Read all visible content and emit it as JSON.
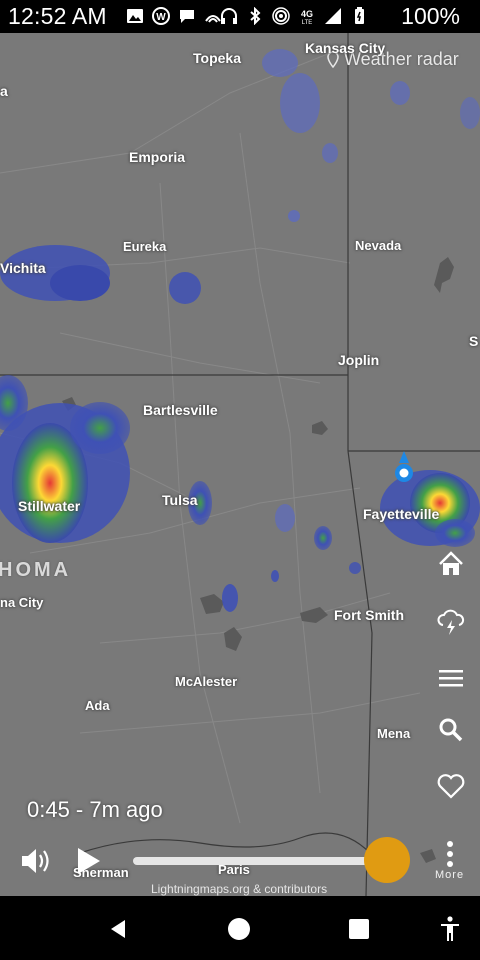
{
  "status_bar": {
    "time": "12:52 AM",
    "battery_percent": "100%",
    "left_icons": [
      "image-icon",
      "wordpress-icon",
      "chat-icon",
      "wifi-calling-icon"
    ],
    "right_icons": [
      "headphones-icon",
      "bluetooth-icon",
      "hotspot-icon",
      "4g-lte-icon",
      "signal-icon",
      "battery-icon"
    ]
  },
  "map": {
    "title": "Weather radar",
    "state_label": "HOMA",
    "cities": [
      {
        "id": "topeka",
        "name": "Topeka"
      },
      {
        "id": "kansas-city",
        "name": "Kansas City"
      },
      {
        "id": "edge-a",
        "name": "a"
      },
      {
        "id": "emporia",
        "name": "Emporia"
      },
      {
        "id": "eureka",
        "name": "Eureka"
      },
      {
        "id": "nevada",
        "name": "Nevada"
      },
      {
        "id": "wichita",
        "name": "Vichita"
      },
      {
        "id": "edge-s",
        "name": "S"
      },
      {
        "id": "joplin",
        "name": "Joplin"
      },
      {
        "id": "bartlesville",
        "name": "Bartlesville"
      },
      {
        "id": "tulsa",
        "name": "Tulsa"
      },
      {
        "id": "stillwater",
        "name": "Stillwater"
      },
      {
        "id": "fayetteville",
        "name": "Fayetteville"
      },
      {
        "id": "oklahoma-city",
        "name": "na City"
      },
      {
        "id": "fort-smith",
        "name": "Fort Smith"
      },
      {
        "id": "mcalester",
        "name": "McAlester"
      },
      {
        "id": "ada",
        "name": "Ada"
      },
      {
        "id": "mena",
        "name": "Mena"
      },
      {
        "id": "sherman",
        "name": "Sherman"
      },
      {
        "id": "paris",
        "name": "Paris"
      }
    ]
  },
  "side_buttons": [
    "home-icon",
    "lightning-cloud-icon",
    "menu-icon",
    "search-icon",
    "favorite-heart-icon"
  ],
  "playback": {
    "timestamp": "0:45 - 7m ago",
    "progress": 1.0,
    "more_label": "More"
  },
  "attribution": "Lightningmaps.org & contributors",
  "colors": {
    "map_background": "#797979",
    "slider_knob": "#e09b12",
    "location_marker": "#1e88e5"
  }
}
